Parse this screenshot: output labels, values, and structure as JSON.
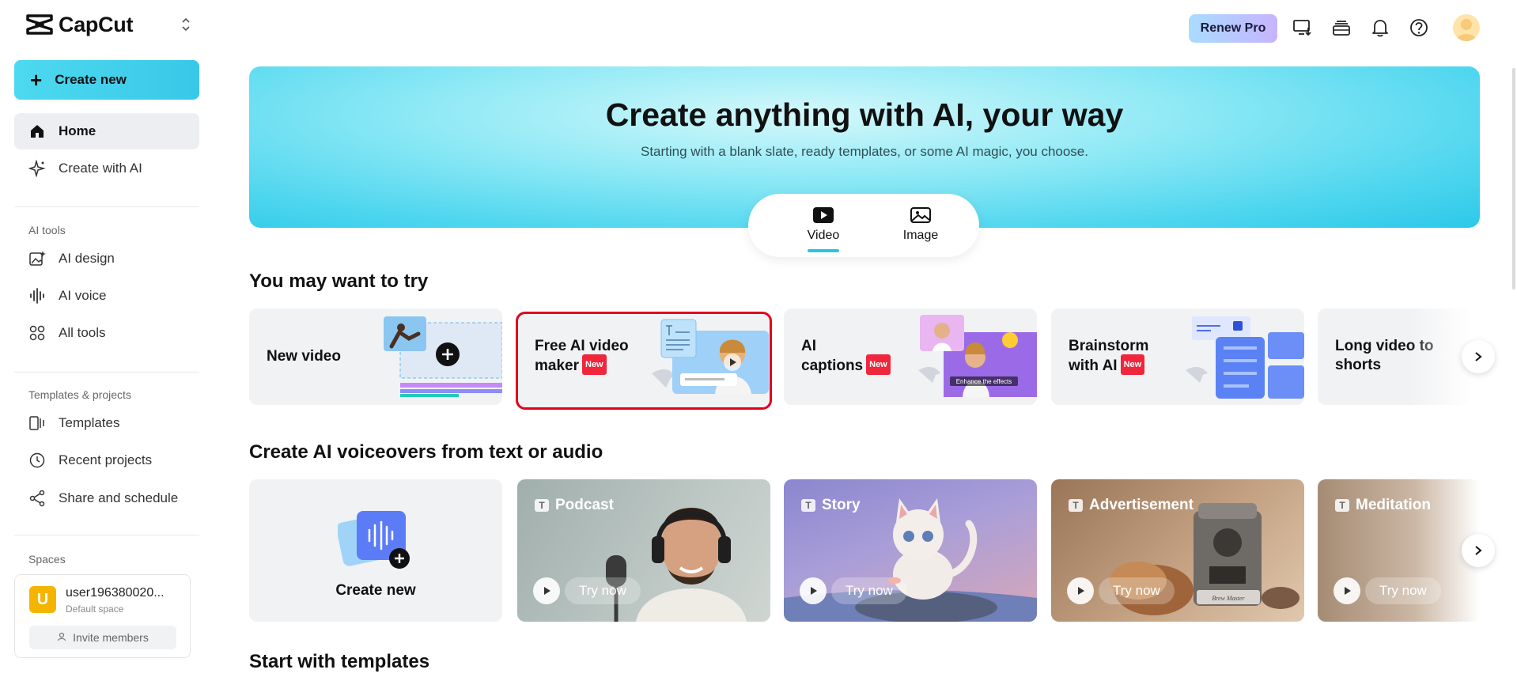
{
  "sidebar": {
    "brand": "CapCut",
    "create_label": "Create new",
    "nav": [
      {
        "label": "Home"
      },
      {
        "label": "Create with AI"
      }
    ],
    "ai_tools_heading": "AI tools",
    "ai_tools": [
      {
        "label": "AI design"
      },
      {
        "label": "AI voice"
      },
      {
        "label": "All tools"
      }
    ],
    "projects_heading": "Templates & projects",
    "projects": [
      {
        "label": "Templates"
      },
      {
        "label": "Recent projects"
      },
      {
        "label": "Share and schedule"
      }
    ],
    "spaces_heading": "Spaces",
    "space": {
      "initial": "U",
      "name": "user196380020...",
      "subtitle": "Default space",
      "invite_label": "Invite members"
    }
  },
  "topbar": {
    "renew_label": "Renew Pro",
    "icons": [
      "download-desktop-icon",
      "stack-icon",
      "bell-icon",
      "help-icon"
    ]
  },
  "hero": {
    "title": "Create anything with AI, your way",
    "subtitle": "Starting with a blank slate, ready templates, or some AI magic, you choose.",
    "tabs": [
      {
        "label": "Video",
        "selected": true
      },
      {
        "label": "Image",
        "selected": false
      }
    ]
  },
  "try_section": {
    "title": "You may want to try",
    "cards": [
      {
        "line1": "New video",
        "line2": "",
        "badge": ""
      },
      {
        "line1": "Free AI video",
        "line2": "maker",
        "badge": "New"
      },
      {
        "line1": "AI",
        "line2": "captions",
        "badge": "New"
      },
      {
        "line1": "Brainstorm",
        "line2": "with AI",
        "badge": "New"
      },
      {
        "line1": "Long video to",
        "line2": "shorts",
        "badge": ""
      }
    ],
    "caption_thumb_text": "Enhance the effects"
  },
  "voiceover_section": {
    "title": "Create AI voiceovers from text or audio",
    "create_label": "Create new",
    "try_label": "Try now",
    "cards": [
      {
        "label": "Podcast"
      },
      {
        "label": "Story"
      },
      {
        "label": "Advertisement"
      },
      {
        "label": "Meditation"
      }
    ],
    "machine_text": "Brew Master"
  },
  "templates_section": {
    "title": "Start with templates"
  },
  "colors": {
    "accent": "#2dc4e3",
    "new_badge": "#f0263c",
    "highlight_outline": "#e3001b"
  }
}
